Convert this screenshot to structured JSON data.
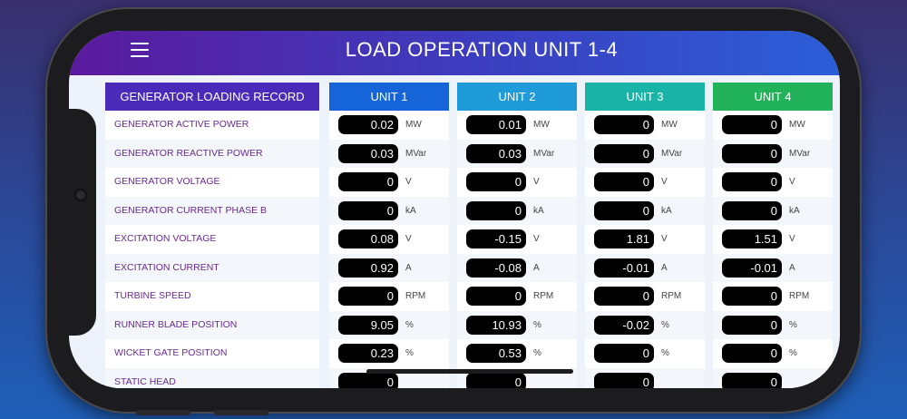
{
  "header": {
    "title": "LOAD OPERATION UNIT 1-4"
  },
  "labels_header": "GENERATOR LOADING RECORD",
  "rows": [
    "GENERATOR ACTIVE POWER",
    "GENERATOR REACTIVE POWER",
    "GENERATOR VOLTAGE",
    "GENERATOR CURRENT PHASE B",
    "EXCITATION VOLTAGE",
    "EXCITATION CURRENT",
    "TURBINE SPEED",
    "RUNNER BLADE POSITION",
    "WICKET GATE POSITION",
    "STATIC HEAD"
  ],
  "units_of_measure": [
    "MW",
    "MVar",
    "V",
    "kA",
    "V",
    "A",
    "RPM",
    "%",
    "%",
    ""
  ],
  "units": [
    {
      "name": "UNIT 1",
      "color": "#1565d8",
      "values": [
        "0.02",
        "0.03",
        "0",
        "0",
        "0.08",
        "0.92",
        "0",
        "9.05",
        "0.23",
        "0"
      ]
    },
    {
      "name": "UNIT 2",
      "color": "#1e9bd8",
      "values": [
        "0.01",
        "0.03",
        "0",
        "0",
        "-0.15",
        "-0.08",
        "0",
        "10.93",
        "0.53",
        "0"
      ]
    },
    {
      "name": "UNIT 3",
      "color": "#19b3a8",
      "values": [
        "0",
        "0",
        "0",
        "0",
        "1.81",
        "-0.01",
        "0",
        "-0.02",
        "0",
        "0"
      ]
    },
    {
      "name": "UNIT 4",
      "color": "#22b35a",
      "values": [
        "0",
        "0",
        "0",
        "0",
        "1.51",
        "-0.01",
        "0",
        "0",
        "0",
        "0"
      ]
    }
  ],
  "labels_header_color": "#4a2ab8"
}
